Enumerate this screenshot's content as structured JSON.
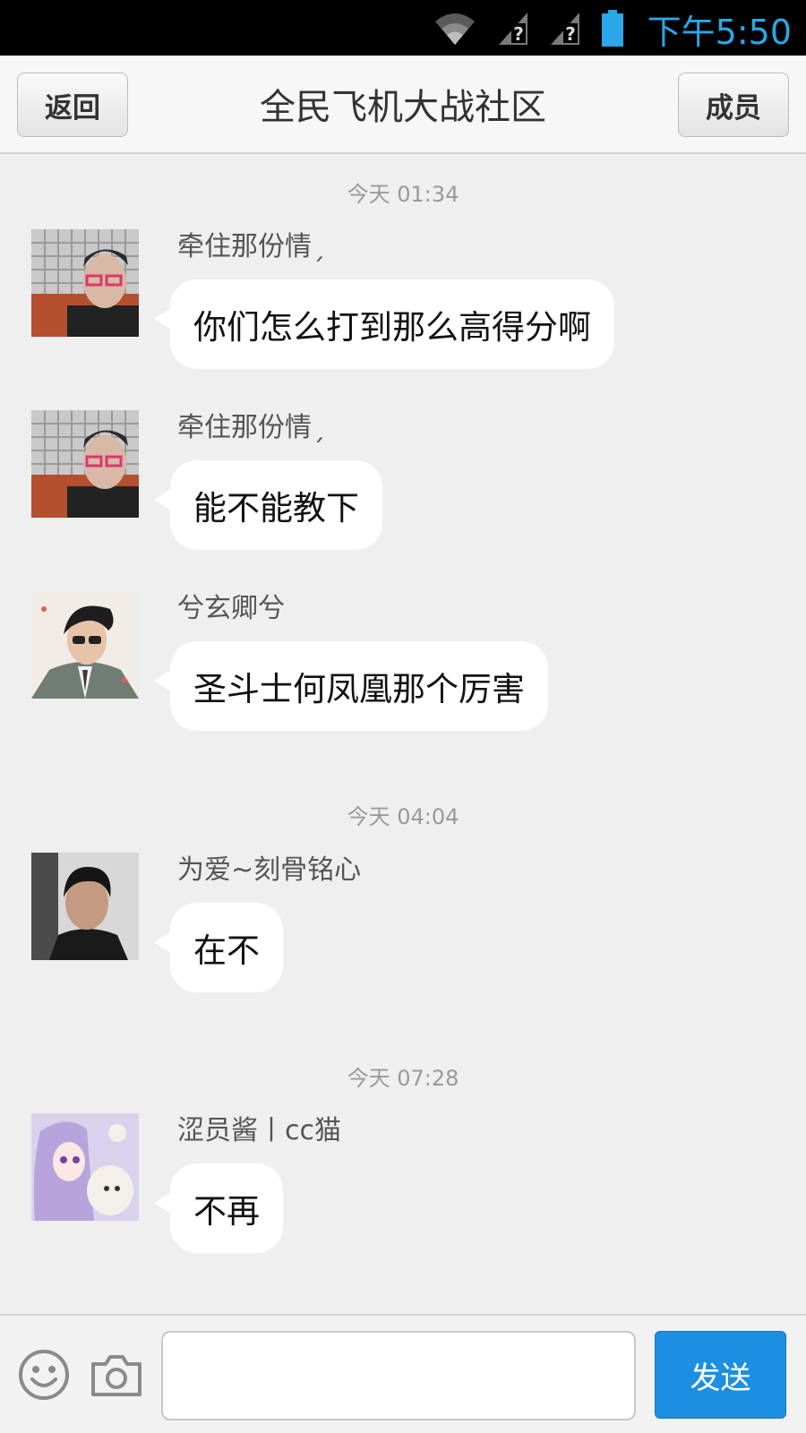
{
  "status_bar": {
    "time": "下午5:50",
    "icons": [
      "wifi-icon",
      "signal-unknown-icon",
      "signal-unknown-icon",
      "battery-icon"
    ],
    "accent_color": "#2aa7e8"
  },
  "header": {
    "back_label": "返回",
    "title": "全民飞机大战社区",
    "members_label": "成员"
  },
  "chat": {
    "timestamps": [
      "今天 01:34",
      "今天 04:04",
      "今天 07:28"
    ],
    "messages": [
      {
        "sender": "牵住那份情ˏ",
        "text": "你们怎么打到那么高得分啊",
        "avatar": "avatar-glasses-man"
      },
      {
        "sender": "牵住那份情ˏ",
        "text": "能不能教下",
        "avatar": "avatar-glasses-man"
      },
      {
        "sender": "兮玄卿兮",
        "text": "圣斗士何凤凰那个厉害",
        "avatar": "avatar-cartoon-man-sunglasses"
      },
      {
        "sender": "为爱~刻骨铭心",
        "text": "在不",
        "avatar": "avatar-young-man"
      },
      {
        "sender": "涩员酱丨cc猫",
        "text": "不再",
        "avatar": "avatar-anime-girl"
      }
    ]
  },
  "input_bar": {
    "icons": [
      "emoji-icon",
      "camera-icon"
    ],
    "input_value": "",
    "send_label": "发送",
    "send_color": "#1c8fe2"
  }
}
